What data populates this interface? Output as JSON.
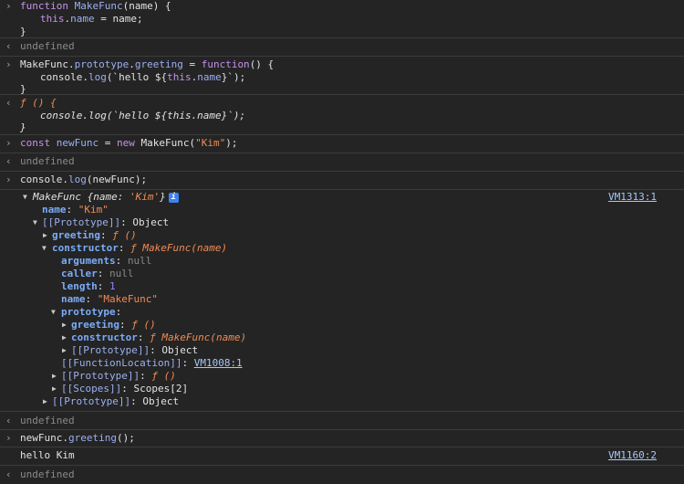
{
  "entries": {
    "e1": {
      "l1a": "function ",
      "l1b": "MakeFunc",
      "l1c": "(name) {",
      "l2a": "this",
      "l2b": ".",
      "l2c": "name",
      "l2d": " = name;",
      "l3": "}"
    },
    "r1": "undefined",
    "e2": {
      "l1a": "MakeFunc.",
      "l1b": "prototype",
      "l1c": ".",
      "l1d": "greeting",
      "l1e": " = ",
      "l1f": "function",
      "l1g": "() {",
      "l2a": "console.",
      "l2b": "log",
      "l2c": "(`hello ${",
      "l2d": "this",
      "l2e": ".",
      "l2f": "name",
      "l2g": "}`);",
      "l3": "}"
    },
    "r2": {
      "l1": "ƒ () {",
      "l2": "console.log(`hello ${this.name}`);",
      "l3": "}"
    },
    "e3": {
      "a": "const ",
      "b": "newFunc",
      "c": " = ",
      "d": "new ",
      "e": "MakeFunc(",
      "f": "\"Kim\"",
      "g": ");"
    },
    "r3": "undefined",
    "e4": {
      "a": "console.",
      "b": "log",
      "c": "(newFunc);"
    },
    "obj": {
      "head_a": "MakeFunc ",
      "head_b": "{name: ",
      "head_c": "'Kim'",
      "head_d": "}",
      "info": "i",
      "source": "VM1313:1",
      "name_key": "name",
      "name_val": "\"Kim\"",
      "proto_key": "[[Prototype]]",
      "proto_val": "Object",
      "greeting_key": "greeting",
      "greeting_val": "ƒ ()",
      "ctor_key": "constructor",
      "ctor_val": "ƒ MakeFunc(name)",
      "args_key": "arguments",
      "args_val": "null",
      "caller_key": "caller",
      "caller_val": "null",
      "length_key": "length",
      "length_val": "1",
      "fname_key": "name",
      "fname_val": "\"MakeFunc\"",
      "prototype_key": "prototype",
      "p_greeting_key": "greeting",
      "p_greeting_val": "ƒ ()",
      "p_ctor_key": "constructor",
      "p_ctor_val": "ƒ MakeFunc(name)",
      "p_proto_key": "[[Prototype]]",
      "p_proto_val": "Object",
      "floc_key": "[[FunctionLocation]]",
      "floc_val": "VM1008:1",
      "f_proto_key": "[[Prototype]]",
      "f_proto_val": "ƒ ()",
      "scopes_key": "[[Scopes]]",
      "scopes_val": "Scopes[2]",
      "o_proto_key": "[[Prototype]]",
      "o_proto_val": "Object"
    },
    "r4": "undefined",
    "e5": {
      "a": "newFunc.",
      "b": "greeting",
      "c": "();"
    },
    "log5": {
      "text": "hello Kim",
      "source": "VM1160:2"
    },
    "r5": "undefined"
  },
  "sep": ": ",
  "prompt_icon": "›",
  "result_icon": "‹",
  "expand_icon": "▶",
  "collapse_icon": "▼"
}
